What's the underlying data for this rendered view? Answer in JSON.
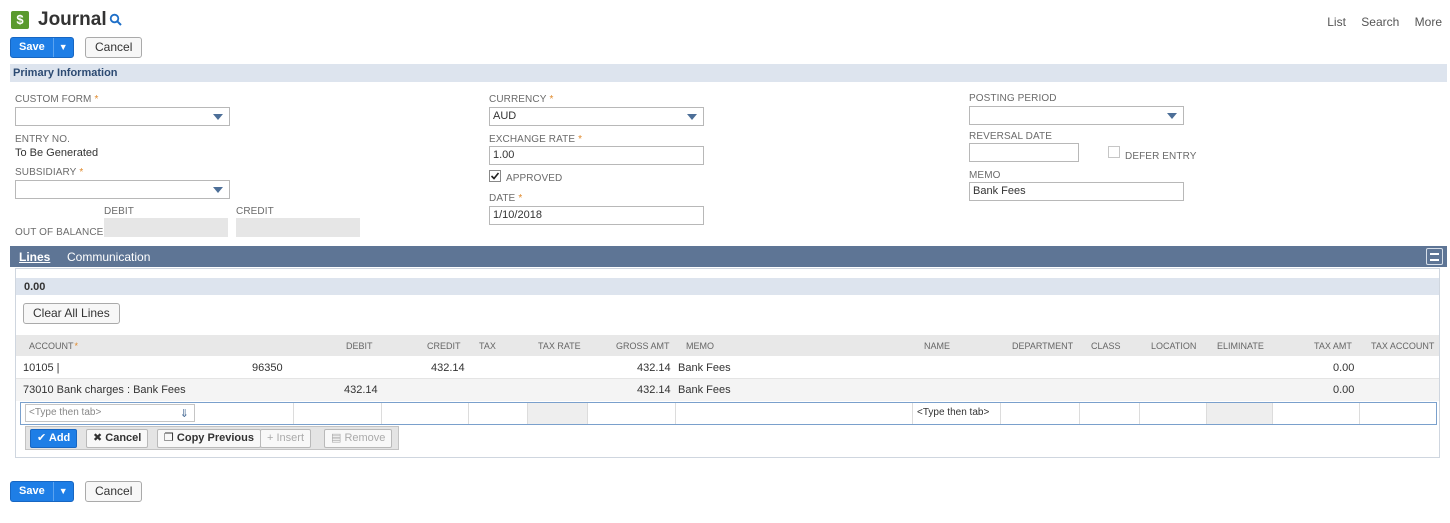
{
  "header": {
    "title": "Journal",
    "links": [
      "List",
      "Search",
      "More"
    ]
  },
  "buttons": {
    "save": "Save",
    "cancel": "Cancel"
  },
  "primary": {
    "section_title": "Primary Information",
    "custom_form_label": "CUSTOM FORM",
    "custom_form_value": "",
    "entry_no_label": "ENTRY NO.",
    "entry_no_value": "To Be Generated",
    "subsidiary_label": "SUBSIDIARY",
    "subsidiary_value": "",
    "debit_label": "DEBIT",
    "credit_label": "CREDIT",
    "out_of_balance_label": "OUT OF BALANCE BY",
    "currency_label": "CURRENCY",
    "currency_value": "AUD",
    "exchange_rate_label": "EXCHANGE RATE",
    "exchange_rate_value": "1.00",
    "approved_label": "APPROVED",
    "date_label": "DATE",
    "date_value": "1/10/2018",
    "posting_period_label": "POSTING PERIOD",
    "reversal_date_label": "REVERSAL DATE",
    "defer_entry_label": "DEFER ENTRY",
    "memo_label": "MEMO",
    "memo_value": "Bank Fees"
  },
  "tabs": [
    "Lines",
    "Communication"
  ],
  "lines": {
    "total": "0.00",
    "clear_all": "Clear All Lines",
    "columns": {
      "account": "ACCOUNT",
      "debit": "DEBIT",
      "credit": "CREDIT",
      "tax": "TAX",
      "tax_rate": "TAX RATE",
      "gross_amt": "GROSS AMT",
      "memo": "MEMO",
      "name": "NAME",
      "department": "DEPARTMENT",
      "class": "CLASS",
      "location": "LOCATION",
      "eliminate": "ELIMINATE",
      "tax_amt": "TAX AMT",
      "tax_account": "TAX ACCOUNT"
    },
    "rows": [
      {
        "account": "10105 |",
        "account_extra": "96350",
        "debit": "",
        "credit": "432.14",
        "gross_amt": "432.14",
        "memo": "Bank Fees",
        "tax_amt": "0.00"
      },
      {
        "account": "73010 Bank charges : Bank Fees",
        "account_extra": "",
        "debit": "432.14",
        "credit": "",
        "gross_amt": "432.14",
        "memo": "Bank Fees",
        "tax_amt": "0.00"
      }
    ],
    "edit_placeholder": "<Type then tab>",
    "name_placeholder": "<Type then tab>",
    "actions": {
      "add": "Add",
      "cancel": "Cancel",
      "copy_previous": "Copy Previous",
      "insert": "Insert",
      "remove": "Remove"
    }
  },
  "colors": {
    "accent": "#1e7ee6",
    "tabbar": "#5e7595",
    "section": "#dde4ee",
    "required": "#e08a2c"
  }
}
